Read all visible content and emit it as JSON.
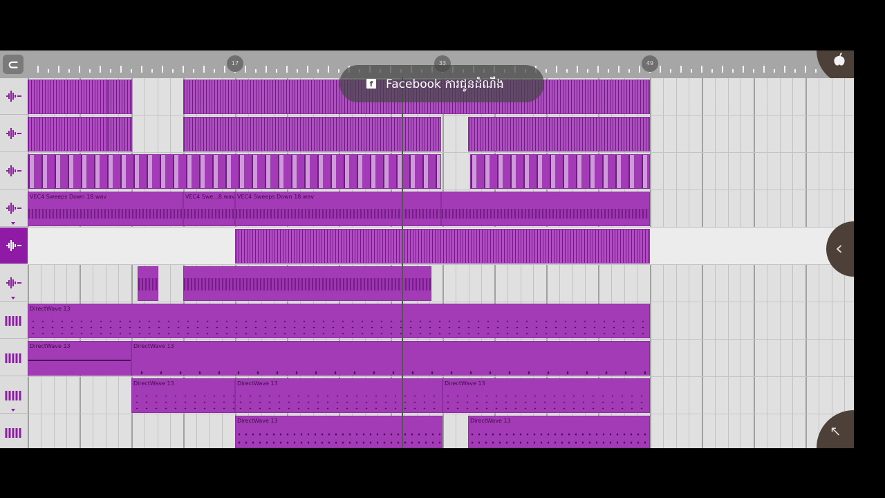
{
  "ruler": {
    "markers": [
      "17",
      "33",
      "49"
    ]
  },
  "toast": {
    "icon": "facebook-icon",
    "text": "Facebook  ការជូនដំណឹង"
  },
  "tracks": [
    {
      "type": "audio",
      "icon": "waveform-icon",
      "selected": false
    },
    {
      "type": "audio",
      "icon": "waveform-icon",
      "selected": false
    },
    {
      "type": "audio",
      "icon": "waveform-icon",
      "selected": false
    },
    {
      "type": "audio",
      "icon": "waveform-icon",
      "selected": false,
      "expand": true
    },
    {
      "type": "audio",
      "icon": "waveform-icon",
      "selected": true
    },
    {
      "type": "audio",
      "icon": "waveform-icon",
      "selected": false,
      "expand": true
    },
    {
      "type": "instrument",
      "icon": "piano-keys-icon",
      "selected": false
    },
    {
      "type": "instrument",
      "icon": "piano-keys-icon",
      "selected": false
    },
    {
      "type": "instrument",
      "icon": "piano-keys-icon",
      "selected": false,
      "expand": true
    },
    {
      "type": "instrument",
      "icon": "piano-keys-icon",
      "selected": false
    }
  ],
  "clip_labels": {
    "sweep_a": "VEC4 Sweeps Down 18.wav",
    "sweep_b": "VEC4 Swe...8.wav",
    "sweep_c": "VEC4 Sweeps Down 18.wav",
    "dw": "DirectWave 13"
  },
  "colors": {
    "clip": "#a43bb6",
    "selected_track": "#8e1aa6",
    "app_background": "#cfcfcf"
  },
  "buttons": {
    "collapse_icon": "chevron-left-icon",
    "corner_icon": "arrow-up-left-icon",
    "fruit_icon": "fruit-logo-icon",
    "magnet_icon": "magnet-icon"
  }
}
